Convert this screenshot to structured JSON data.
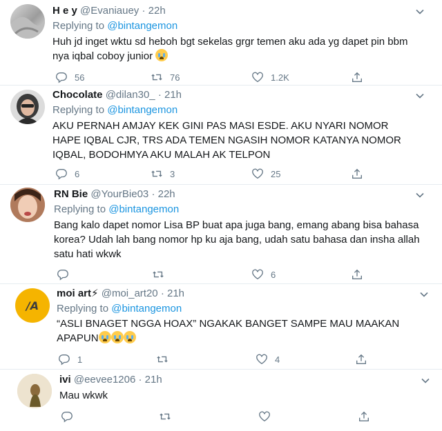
{
  "tweets": [
    {
      "name": "H e y",
      "handle": "@Evaniauey",
      "time": "22h",
      "replying_prefix": "Replying to",
      "replying_to": "@bintangemon",
      "text": "Huh jd inget wktu sd heboh bgt sekelas grgr temen aku ada yg dapet pin bbm nya iqbal coboy junior",
      "emojis": 1,
      "replies": "56",
      "retweets": "76",
      "likes": "1.2K"
    },
    {
      "name": "Chocolate",
      "handle": "@dilan30_",
      "time": "21h",
      "replying_prefix": "Replying to",
      "replying_to": "@bintangemon",
      "text": "AKU PERNAH AMJAY KEK GINI PAS MASI ESDE. AKU NYARI NOMOR HAPE IQBAL CJR, TRS ADA TEMEN NGASIH NOMOR KATANYA NOMOR IQBAL, BODOHMYA AKU MALAH AK TELPON",
      "emojis": 0,
      "replies": "6",
      "retweets": "3",
      "likes": "25"
    },
    {
      "name": "RN Bie",
      "handle": "@YourBie03",
      "time": "22h",
      "replying_prefix": "Replying to",
      "replying_to": "@bintangemon",
      "text": "Bang kalo dapet nomor Lisa BP buat apa juga bang, emang abang bisa bahasa korea? Udah lah bang nomor hp ku aja bang, udah satu bahasa dan insha allah satu hati wkwk",
      "emojis": 0,
      "replies": "",
      "retweets": "",
      "likes": "6"
    },
    {
      "name": "moi art⚡",
      "handle": "@moi_art20",
      "time": "21h",
      "replying_prefix": "Replying to",
      "replying_to": "@bintangemon",
      "text": "“ASLI BNAGET NGGA HOAX” NGAKAK BANGET SAMPE MAU MAAKAN APAPUN",
      "emojis": 3,
      "replies": "1",
      "retweets": "",
      "likes": "4",
      "avatar_text": "/A"
    },
    {
      "name": "ivi",
      "handle": "@eevee1206",
      "time": "21h",
      "replying_prefix": "",
      "replying_to": "",
      "text": "Mau wkwk",
      "emojis": 0,
      "replies": "",
      "retweets": "",
      "likes": ""
    }
  ],
  "colors": {
    "link": "#1b95e0",
    "muted": "#657786",
    "text": "#14171a",
    "divider": "#e6ecf0"
  }
}
